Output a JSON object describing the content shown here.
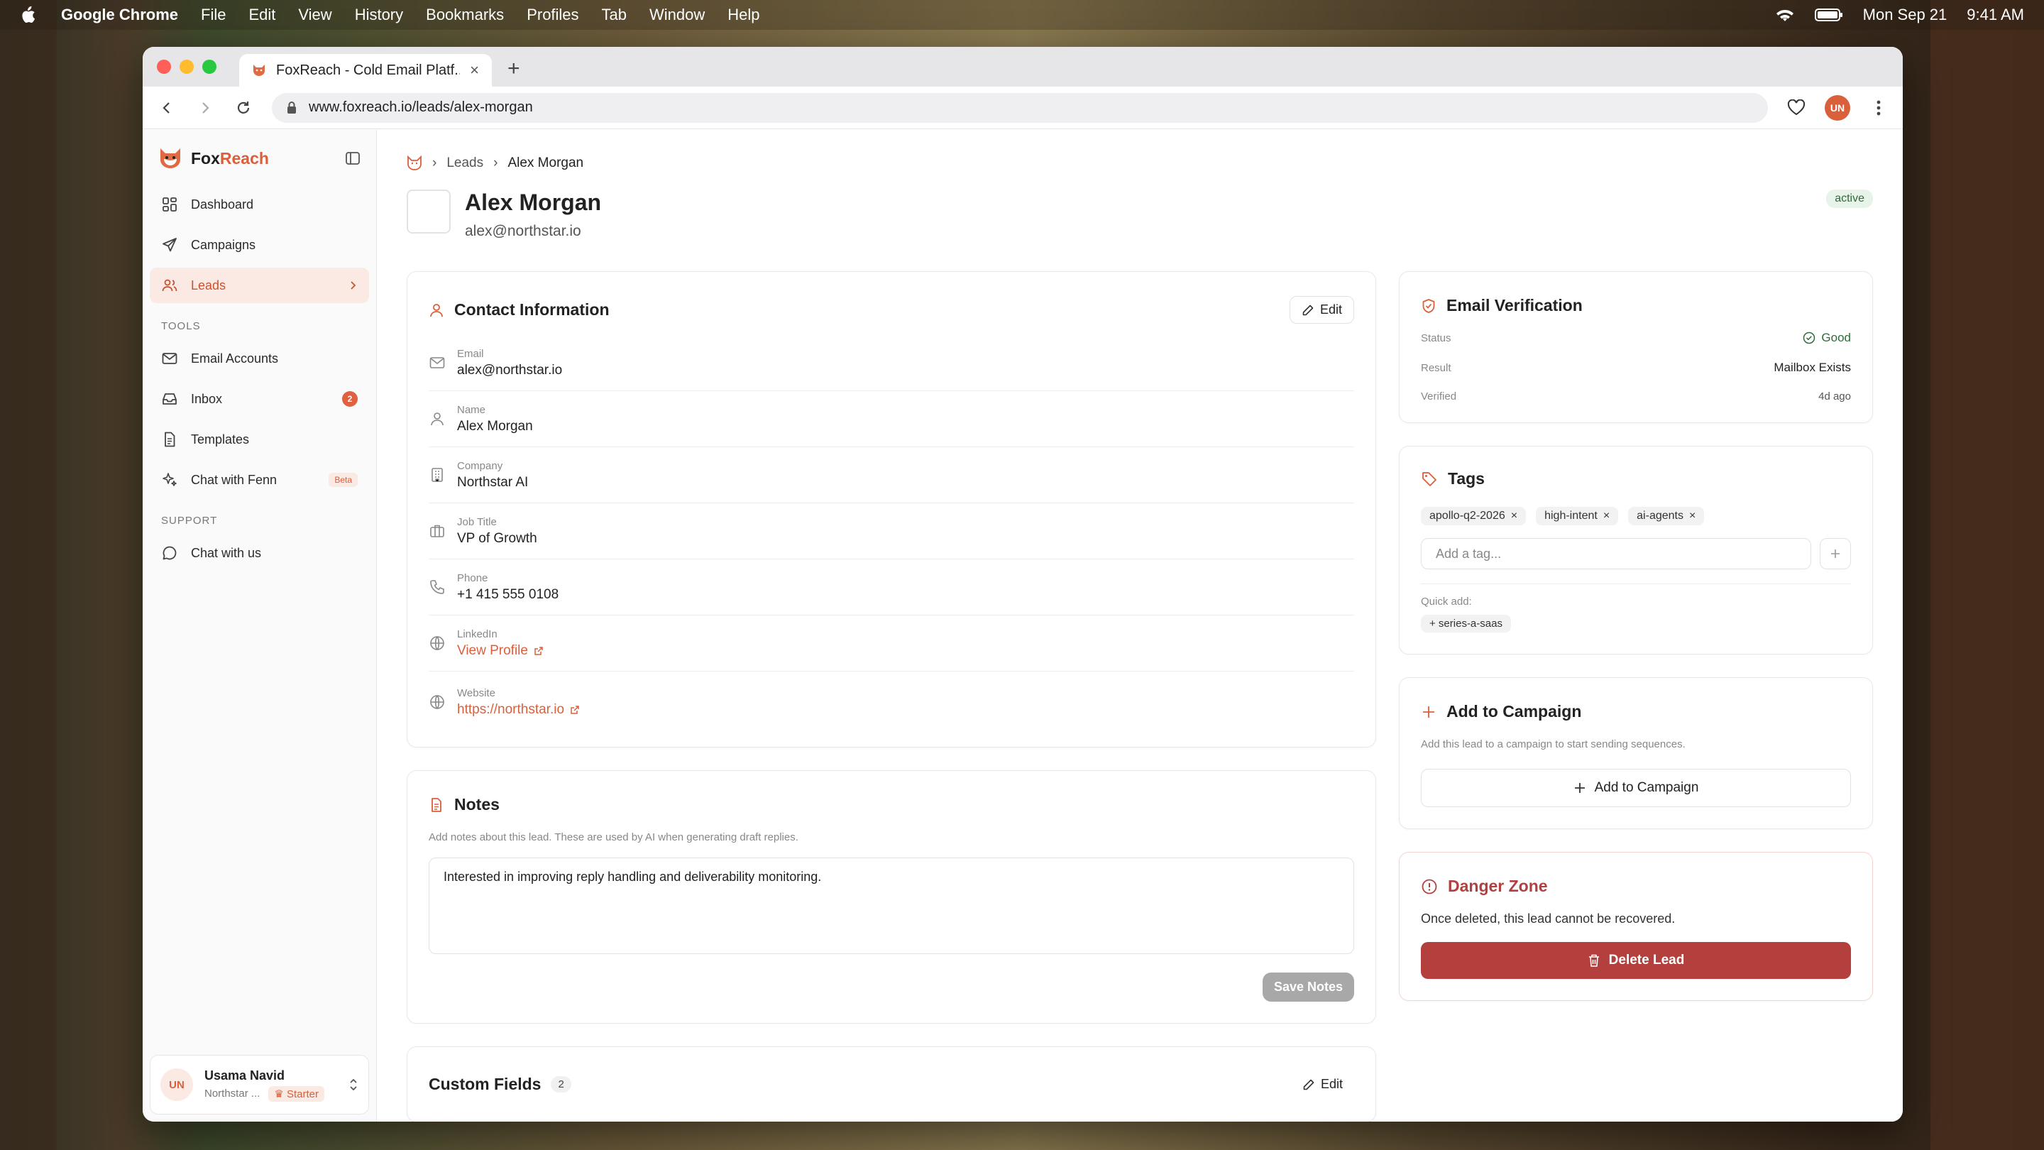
{
  "menubar": {
    "app": "Google Chrome",
    "items": [
      "File",
      "Edit",
      "View",
      "History",
      "Bookmarks",
      "Profiles",
      "Tab",
      "Window",
      "Help"
    ],
    "date": "Mon Sep 21",
    "time": "9:41 AM"
  },
  "browser": {
    "tab_title": "FoxReach - Cold Email Platf...",
    "url": "www.foxreach.io/leads/alex-morgan",
    "profile_initials": "UN"
  },
  "sidebar": {
    "brand_fox": "Fox",
    "brand_reach": "Reach",
    "main_items": [
      {
        "label": "Dashboard"
      },
      {
        "label": "Campaigns"
      },
      {
        "label": "Leads"
      }
    ],
    "tools_label": "TOOLS",
    "tool_items": [
      {
        "label": "Email Accounts"
      },
      {
        "label": "Inbox",
        "badge": "2"
      },
      {
        "label": "Templates"
      },
      {
        "label": "Chat with Fenn",
        "badge": "Beta"
      }
    ],
    "support_label": "SUPPORT",
    "support_items": [
      {
        "label": "Chat with us"
      }
    ],
    "user": {
      "initials": "UN",
      "name": "Usama Navid",
      "org": "Northstar ...",
      "plan": "Starter"
    }
  },
  "breadcrumb": {
    "section": "Leads",
    "current": "Alex Morgan"
  },
  "lead": {
    "name": "Alex Morgan",
    "email": "alex@northstar.io",
    "status": "active"
  },
  "contact": {
    "title": "Contact Information",
    "edit_label": "Edit",
    "fields": [
      {
        "label": "Email",
        "value": "alex@northstar.io"
      },
      {
        "label": "Name",
        "value": "Alex Morgan"
      },
      {
        "label": "Company",
        "value": "Northstar AI"
      },
      {
        "label": "Job Title",
        "value": "VP of Growth"
      },
      {
        "label": "Phone",
        "value": "+1 415 555 0108"
      },
      {
        "label": "LinkedIn",
        "value": "View Profile"
      },
      {
        "label": "Website",
        "value": "https://northstar.io"
      }
    ]
  },
  "notes": {
    "title": "Notes",
    "description": "Add notes about this lead. These are used by AI when generating draft replies.",
    "text": "Interested in improving reply handling and deliverability monitoring.",
    "save_label": "Save Notes"
  },
  "custom_fields": {
    "title": "Custom Fields",
    "count": "2",
    "edit_label": "Edit"
  },
  "verification": {
    "title": "Email Verification",
    "status_label": "Status",
    "status_value": "Good",
    "result_label": "Result",
    "result_value": "Mailbox Exists",
    "verified_label": "Verified",
    "verified_value": "4d ago"
  },
  "tags": {
    "title": "Tags",
    "items": [
      "apollo-q2-2026",
      "high-intent",
      "ai-agents"
    ],
    "input_placeholder": "Add a tag...",
    "quick_add_label": "Quick add:",
    "quick_add_items": [
      "+ series-a-saas"
    ]
  },
  "campaign": {
    "title": "Add to Campaign",
    "description": "Add this lead to a campaign to start sending sequences.",
    "button_label": "Add to Campaign"
  },
  "danger": {
    "title": "Danger Zone",
    "text": "Once deleted, this lead cannot be recovered.",
    "button_label": "Delete Lead"
  },
  "colors": {
    "accent": "#d9603b",
    "danger": "#b4403e",
    "success": "#2f6b3b"
  }
}
